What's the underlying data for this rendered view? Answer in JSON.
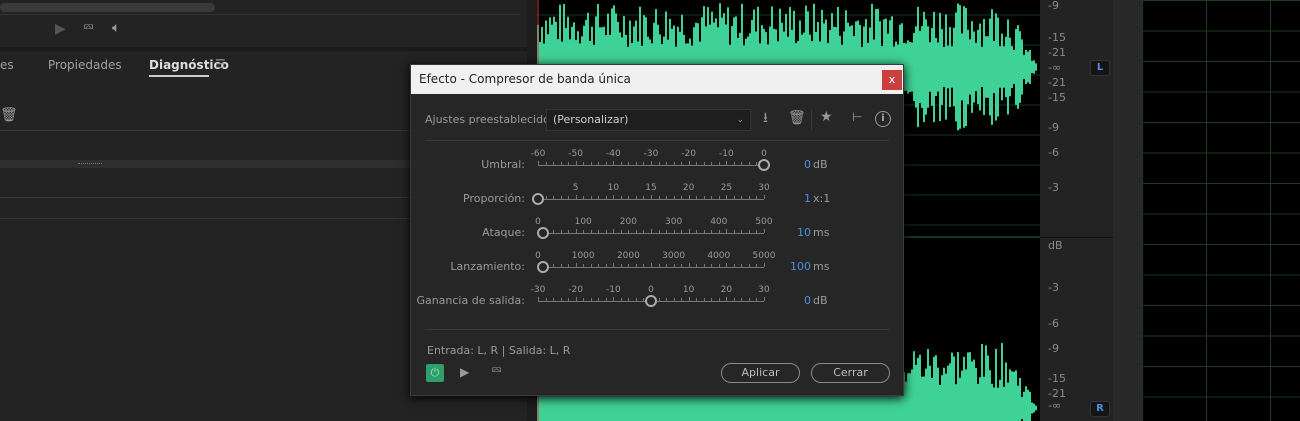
{
  "left_panel": {
    "tabs": [
      {
        "label": "es"
      },
      {
        "label": "Propiedades"
      },
      {
        "label": "Diagnóstico",
        "active": true
      }
    ]
  },
  "ruler": {
    "upper": [
      "-9",
      "-15",
      "-21",
      "-∞",
      "-21",
      "-15",
      "-9",
      "-6",
      "-3"
    ],
    "unit": "dB",
    "lower": [
      "-3",
      "-6",
      "-9",
      "-15",
      "-21",
      "-∞"
    ],
    "channel_left": "L",
    "channel_right": "R"
  },
  "dialog": {
    "title": "Efecto - Compresor de banda única",
    "close_label": "x",
    "presets_label": "Ajustes preestablecidos:",
    "preset_value": "(Personalizar)",
    "params": [
      {
        "label": "Umbral:",
        "ticks": [
          "-60",
          "-50",
          "-40",
          "-30",
          "-20",
          "-10",
          "0"
        ],
        "min": -60,
        "max": 0,
        "value": "0",
        "num": 0,
        "unit": "dB"
      },
      {
        "label": "Proporción:",
        "ticks": [
          "5",
          "10",
          "15",
          "20",
          "25",
          "30"
        ],
        "min": 0,
        "max": 30,
        "tickvals": [
          5,
          10,
          15,
          20,
          25,
          30
        ],
        "value": "1",
        "num": 0,
        "unit": "x:1"
      },
      {
        "label": "Ataque:",
        "ticks": [
          "0",
          "100",
          "200",
          "300",
          "400",
          "500"
        ],
        "min": 0,
        "max": 500,
        "value": "10",
        "num": 10,
        "unit": "ms"
      },
      {
        "label": "Lanzamiento:",
        "ticks": [
          "0",
          "1000",
          "2000",
          "3000",
          "4000",
          "5000"
        ],
        "min": 0,
        "max": 5000,
        "value": "100",
        "num": 100,
        "unit": "ms"
      },
      {
        "label": "Ganancia de salida:",
        "ticks": [
          "-30",
          "-20",
          "-10",
          "0",
          "10",
          "20",
          "30"
        ],
        "min": -30,
        "max": 30,
        "value": "0",
        "num": 0,
        "unit": "dB"
      }
    ],
    "io_text": "Entrada: L, R | Salida: L, R",
    "apply_label": "Aplicar",
    "close_button_label": "Cerrar"
  },
  "colors": {
    "waveform": "#3fd296",
    "accent": "#4d8fe0",
    "power": "#2e9e6a"
  }
}
